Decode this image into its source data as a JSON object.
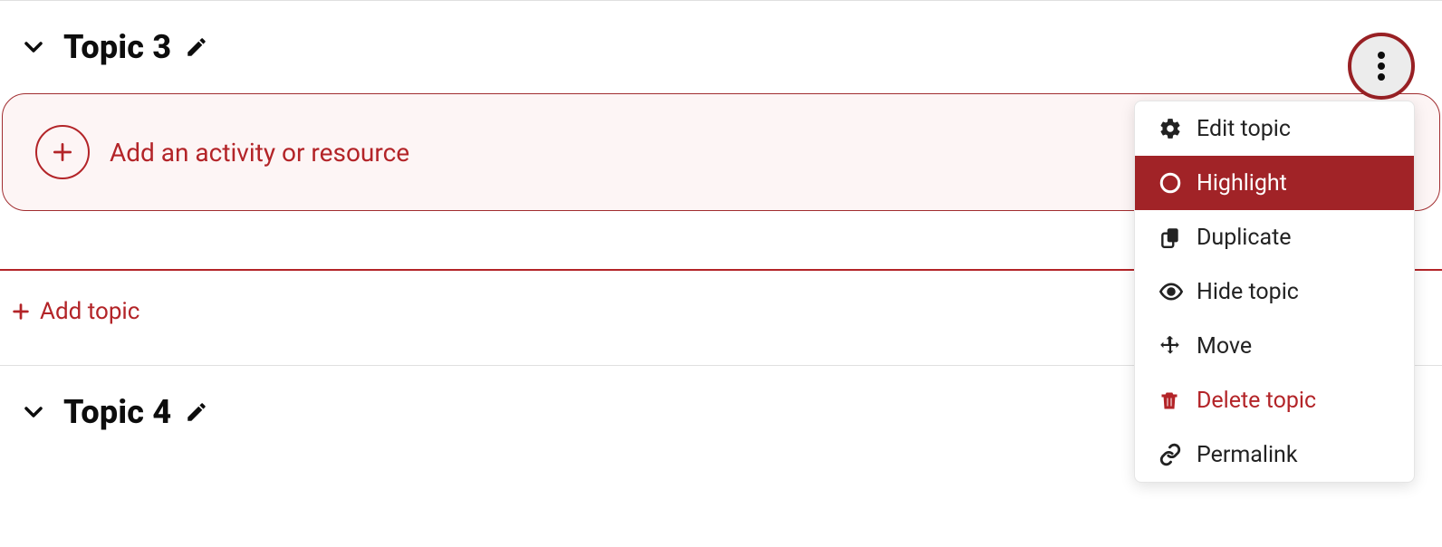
{
  "sections": [
    {
      "title": "Topic 3"
    },
    {
      "title": "Topic 4"
    }
  ],
  "add_activity_label": "Add an activity or resource",
  "add_topic_label": "Add topic",
  "menu": {
    "edit": "Edit topic",
    "highlight": "Highlight",
    "duplicate": "Duplicate",
    "hide": "Hide topic",
    "move": "Move",
    "delete": "Delete topic",
    "permalink": "Permalink"
  }
}
